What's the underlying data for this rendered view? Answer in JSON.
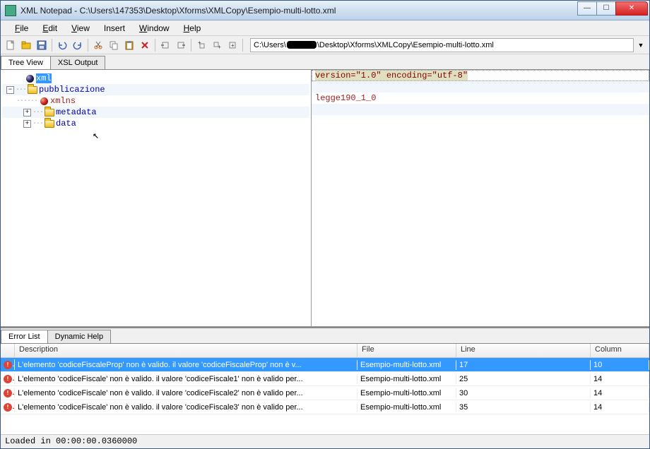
{
  "window": {
    "title": "XML Notepad - C:\\Users\\147353\\Desktop\\Xforms\\XMLCopy\\Esempio-multi-lotto.xml"
  },
  "menu": {
    "file": "File",
    "edit": "Edit",
    "view": "View",
    "insert": "Insert",
    "window": "Window",
    "help": "Help"
  },
  "toolbar": {
    "path_prefix": "C:\\Users\\",
    "path_suffix": "\\Desktop\\Xforms\\XMLCopy\\Esempio-multi-lotto.xml"
  },
  "tabs_top": {
    "tree_view": "Tree View",
    "xsl_output": "XSL Output"
  },
  "tree": {
    "xml": "xml",
    "pubblicazione": "pubblicazione",
    "xmlns": "xmlns",
    "metadata": "metadata",
    "data": "data"
  },
  "values": {
    "row0": "version=\"1.0\" encoding=\"utf-8\"",
    "row2": "legge190_1_0"
  },
  "bottom_tabs": {
    "error_list": "Error List",
    "dynamic_help": "Dynamic Help"
  },
  "grid": {
    "headers": {
      "description": "Description",
      "file": "File",
      "line": "Line",
      "column": "Column"
    },
    "rows": [
      {
        "desc": "L'elemento 'codiceFiscaleProp' non è valido. il valore 'codiceFiscaleProp' non è v...",
        "file": "Esempio-multi-lotto.xml",
        "line": "17",
        "col": "10"
      },
      {
        "desc": "L'elemento 'codiceFiscale' non è valido. il valore 'codiceFiscale1' non è valido per...",
        "file": "Esempio-multi-lotto.xml",
        "line": "25",
        "col": "14"
      },
      {
        "desc": "L'elemento 'codiceFiscale' non è valido. il valore 'codiceFiscale2' non è valido per...",
        "file": "Esempio-multi-lotto.xml",
        "line": "30",
        "col": "14"
      },
      {
        "desc": "L'elemento 'codiceFiscale' non è valido. il valore 'codiceFiscale3' non è valido per...",
        "file": "Esempio-multi-lotto.xml",
        "line": "35",
        "col": "14"
      }
    ]
  },
  "status": "Loaded in 00:00:00.0360000"
}
